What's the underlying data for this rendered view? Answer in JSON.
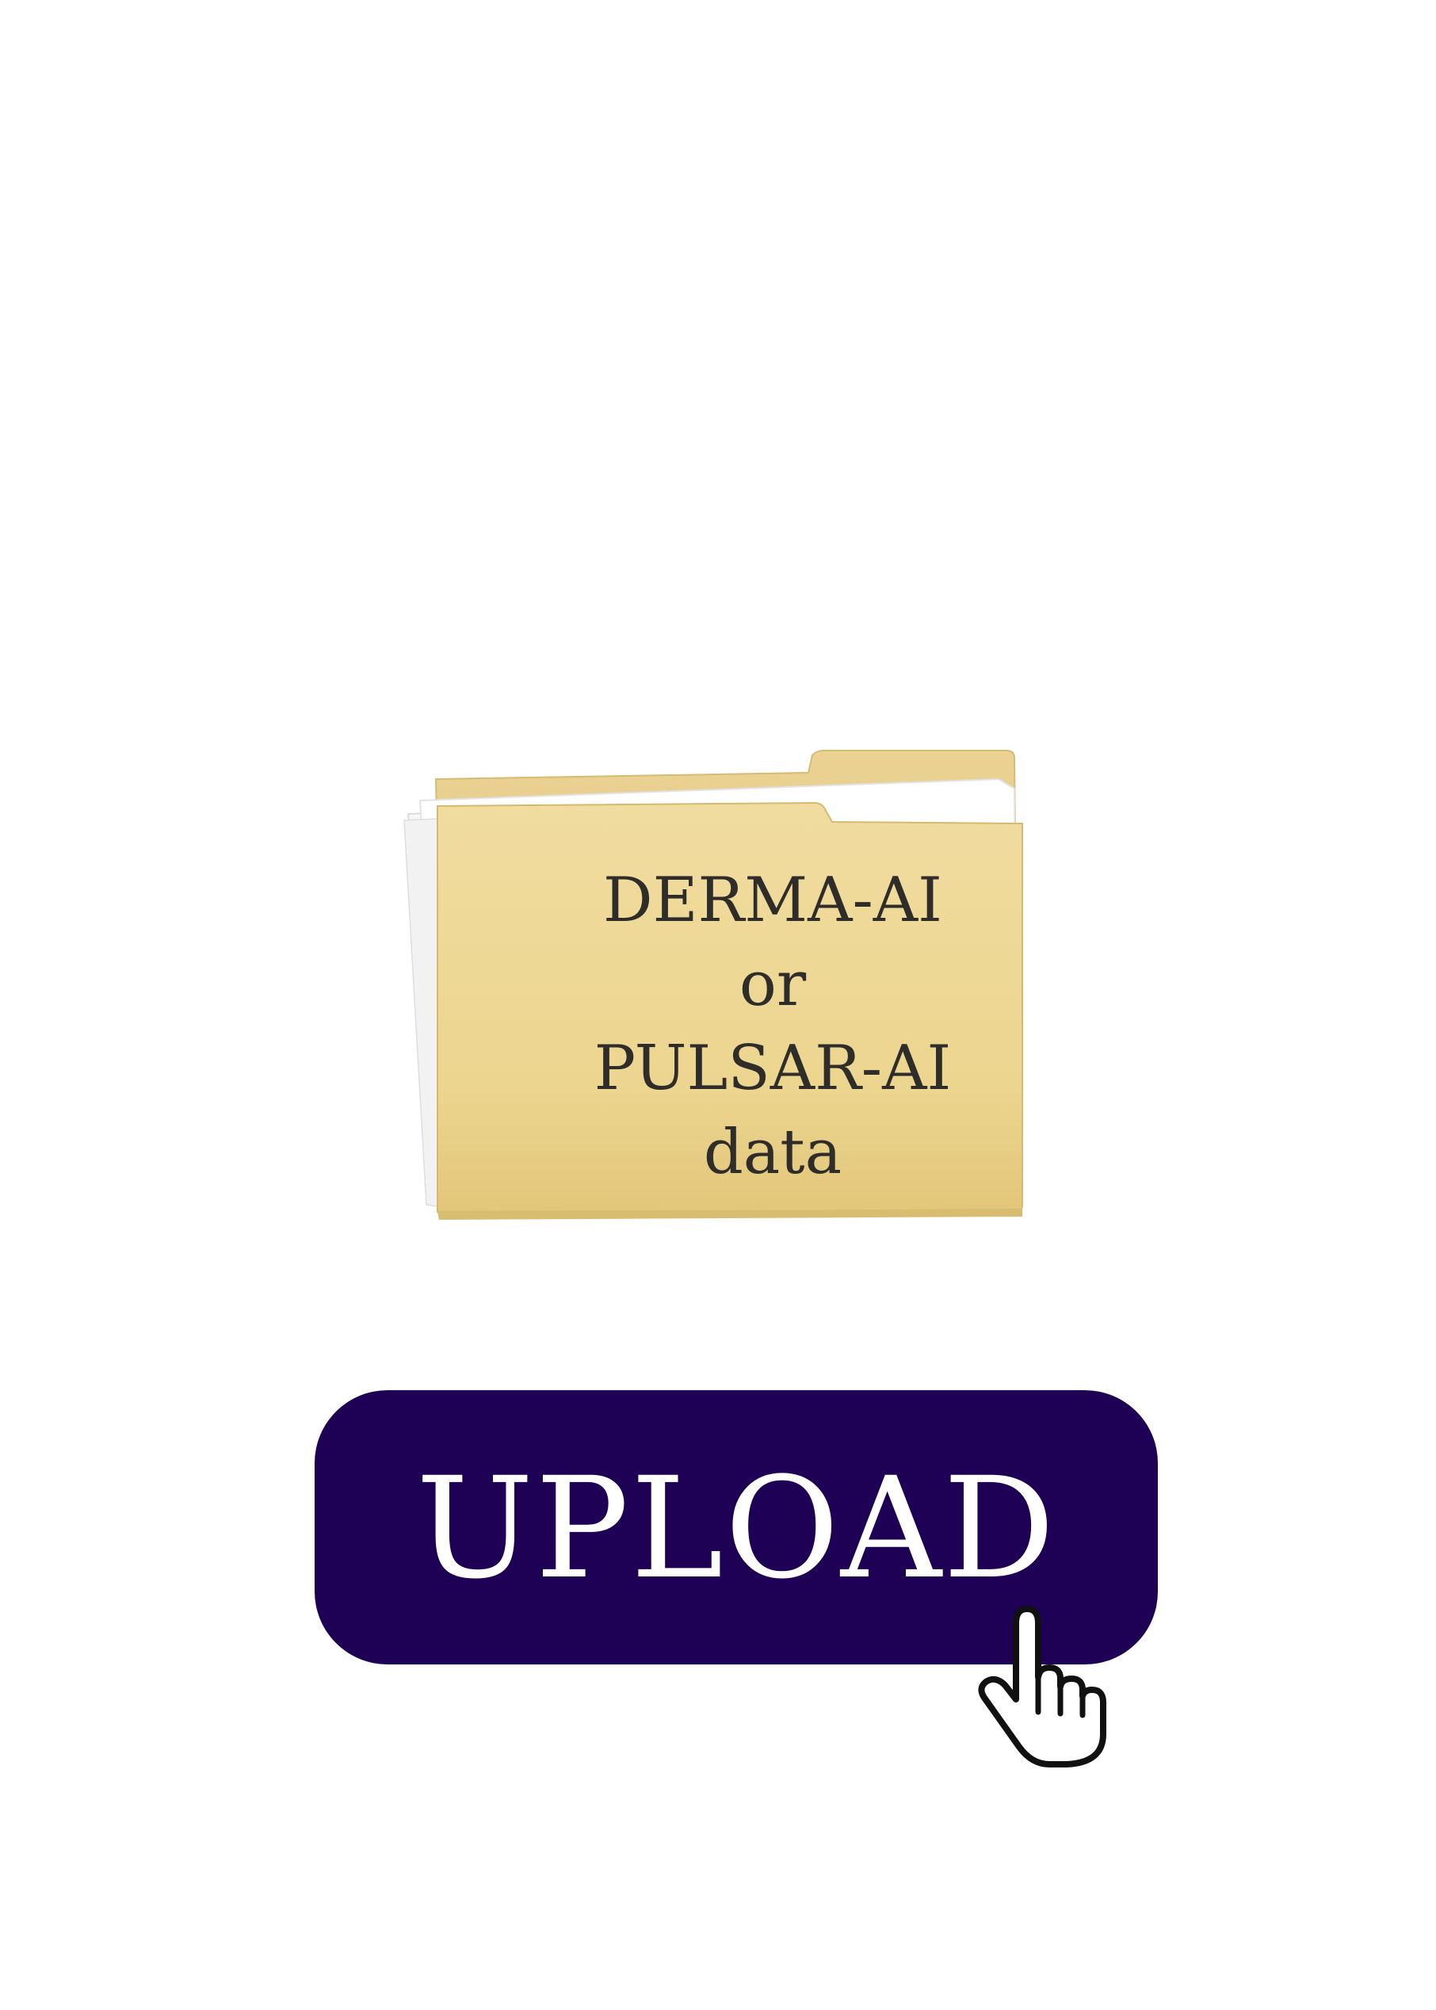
{
  "folder": {
    "lines": [
      "DERMA-AI",
      "or",
      "PULSAR-AI",
      "data"
    ],
    "icon": "folder-icon",
    "color": "#e9cf8a"
  },
  "upload": {
    "label": "UPLOAD",
    "background": "#1e0055"
  },
  "cursor": {
    "icon": "pointer-hand-icon"
  }
}
